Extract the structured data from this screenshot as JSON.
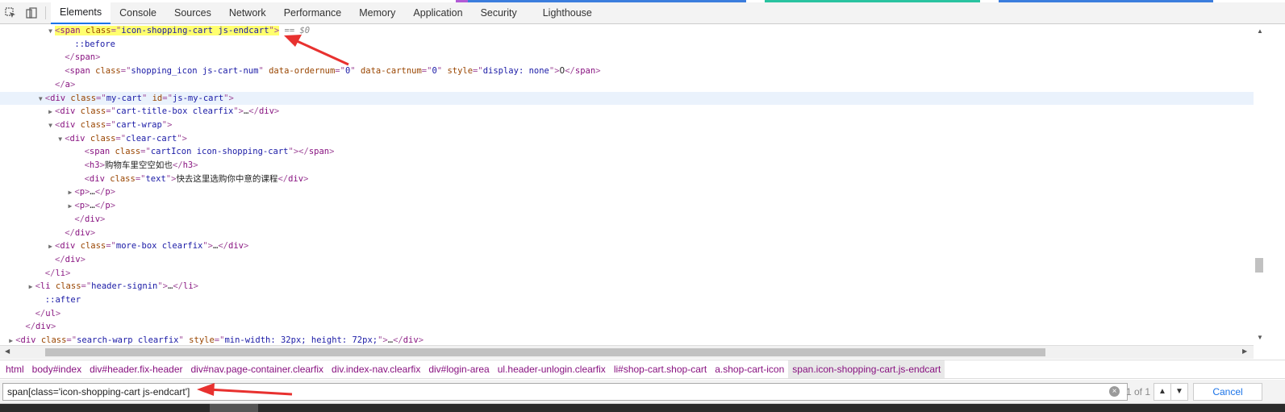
{
  "toolbar": {
    "tabs": [
      {
        "label": "Elements",
        "active": true
      },
      {
        "label": "Console"
      },
      {
        "label": "Sources"
      },
      {
        "label": "Network"
      },
      {
        "label": "Performance"
      },
      {
        "label": "Memory"
      },
      {
        "label": "Application"
      },
      {
        "label": "Security"
      },
      {
        "label": "Lighthouse"
      }
    ],
    "icons": [
      "inspect-icon",
      "device-toggle-icon"
    ]
  },
  "tree": {
    "lines": [
      {
        "indent": 5,
        "tri": "open",
        "selected_hl": true,
        "parts": [
          [
            "br",
            "<"
          ],
          [
            "tag",
            "span"
          ],
          [
            "sp",
            " "
          ],
          [
            "attr",
            "class"
          ],
          [
            "br",
            "=\""
          ],
          [
            "val",
            "icon-shopping-cart js-endcart"
          ],
          [
            "br",
            "\">"
          ]
        ],
        "suffix": " == $0"
      },
      {
        "indent": 7,
        "parts": [
          [
            "pseudo",
            "::before"
          ]
        ]
      },
      {
        "indent": 6,
        "parts": [
          [
            "br",
            "</"
          ],
          [
            "tag",
            "span"
          ],
          [
            "br",
            ">"
          ]
        ]
      },
      {
        "indent": 6,
        "parts": [
          [
            "br",
            "<"
          ],
          [
            "tag",
            "span"
          ],
          [
            "sp",
            " "
          ],
          [
            "attr",
            "class"
          ],
          [
            "br",
            "=\""
          ],
          [
            "val",
            "shopping_icon js-cart-num"
          ],
          [
            "br",
            "\""
          ],
          [
            "sp",
            " "
          ],
          [
            "attr",
            "data-ordernum"
          ],
          [
            "br",
            "=\""
          ],
          [
            "val",
            "0"
          ],
          [
            "br",
            "\""
          ],
          [
            "sp",
            " "
          ],
          [
            "attr",
            "data-cartnum"
          ],
          [
            "br",
            "=\""
          ],
          [
            "val",
            "0"
          ],
          [
            "br",
            "\""
          ],
          [
            "sp",
            " "
          ],
          [
            "attr",
            "style"
          ],
          [
            "br",
            "=\""
          ],
          [
            "val",
            "display: none"
          ],
          [
            "br",
            "\">"
          ],
          [
            "txt",
            "0"
          ],
          [
            "br",
            "</"
          ],
          [
            "tag",
            "span"
          ],
          [
            "br",
            ">"
          ]
        ]
      },
      {
        "indent": 5,
        "parts": [
          [
            "br",
            "</"
          ],
          [
            "tag",
            "a"
          ],
          [
            "br",
            ">"
          ]
        ]
      },
      {
        "indent": 4,
        "tri": "open",
        "selected": true,
        "parts": [
          [
            "br",
            "<"
          ],
          [
            "tag",
            "div"
          ],
          [
            "sp",
            " "
          ],
          [
            "attr",
            "class"
          ],
          [
            "br",
            "=\""
          ],
          [
            "val",
            "my-cart"
          ],
          [
            "br",
            "\""
          ],
          [
            "sp",
            " "
          ],
          [
            "attr",
            "id"
          ],
          [
            "br",
            "=\""
          ],
          [
            "val",
            "js-my-cart"
          ],
          [
            "br",
            "\">"
          ]
        ]
      },
      {
        "indent": 5,
        "tri": "closed",
        "parts": [
          [
            "br",
            "<"
          ],
          [
            "tag",
            "div"
          ],
          [
            "sp",
            " "
          ],
          [
            "attr",
            "class"
          ],
          [
            "br",
            "=\""
          ],
          [
            "val",
            "cart-title-box clearfix"
          ],
          [
            "br",
            "\">"
          ],
          [
            "ell",
            "…"
          ],
          [
            "br",
            "</"
          ],
          [
            "tag",
            "div"
          ],
          [
            "br",
            ">"
          ]
        ]
      },
      {
        "indent": 5,
        "tri": "open",
        "parts": [
          [
            "br",
            "<"
          ],
          [
            "tag",
            "div"
          ],
          [
            "sp",
            " "
          ],
          [
            "attr",
            "class"
          ],
          [
            "br",
            "=\""
          ],
          [
            "val",
            "cart-wrap"
          ],
          [
            "br",
            "\">"
          ]
        ]
      },
      {
        "indent": 6,
        "tri": "open",
        "parts": [
          [
            "br",
            "<"
          ],
          [
            "tag",
            "div"
          ],
          [
            "sp",
            " "
          ],
          [
            "attr",
            "class"
          ],
          [
            "br",
            "=\""
          ],
          [
            "val",
            "clear-cart"
          ],
          [
            "br",
            "\">"
          ]
        ]
      },
      {
        "indent": 8,
        "parts": [
          [
            "br",
            "<"
          ],
          [
            "tag",
            "span"
          ],
          [
            "sp",
            " "
          ],
          [
            "attr",
            "class"
          ],
          [
            "br",
            "=\""
          ],
          [
            "val",
            "cartIcon icon-shopping-cart"
          ],
          [
            "br",
            "\">"
          ],
          [
            "br",
            "</"
          ],
          [
            "tag",
            "span"
          ],
          [
            "br",
            ">"
          ]
        ]
      },
      {
        "indent": 8,
        "parts": [
          [
            "br",
            "<"
          ],
          [
            "tag",
            "h3"
          ],
          [
            "br",
            ">"
          ],
          [
            "txt",
            "购物车里空空如也"
          ],
          [
            "br",
            "</"
          ],
          [
            "tag",
            "h3"
          ],
          [
            "br",
            ">"
          ]
        ]
      },
      {
        "indent": 8,
        "parts": [
          [
            "br",
            "<"
          ],
          [
            "tag",
            "div"
          ],
          [
            "sp",
            " "
          ],
          [
            "attr",
            "class"
          ],
          [
            "br",
            "=\""
          ],
          [
            "val",
            "text"
          ],
          [
            "br",
            "\">"
          ],
          [
            "txt",
            "快去这里选购你中意的课程"
          ],
          [
            "br",
            "</"
          ],
          [
            "tag",
            "div"
          ],
          [
            "br",
            ">"
          ]
        ]
      },
      {
        "indent": 7,
        "tri": "closed",
        "parts": [
          [
            "br",
            "<"
          ],
          [
            "tag",
            "p"
          ],
          [
            "br",
            ">"
          ],
          [
            "ell",
            "…"
          ],
          [
            "br",
            "</"
          ],
          [
            "tag",
            "p"
          ],
          [
            "br",
            ">"
          ]
        ]
      },
      {
        "indent": 7,
        "tri": "closed",
        "parts": [
          [
            "br",
            "<"
          ],
          [
            "tag",
            "p"
          ],
          [
            "br",
            ">"
          ],
          [
            "ell",
            "…"
          ],
          [
            "br",
            "</"
          ],
          [
            "tag",
            "p"
          ],
          [
            "br",
            ">"
          ]
        ]
      },
      {
        "indent": 7,
        "parts": [
          [
            "br",
            "</"
          ],
          [
            "tag",
            "div"
          ],
          [
            "br",
            ">"
          ]
        ]
      },
      {
        "indent": 6,
        "parts": [
          [
            "br",
            "</"
          ],
          [
            "tag",
            "div"
          ],
          [
            "br",
            ">"
          ]
        ]
      },
      {
        "indent": 5,
        "tri": "closed",
        "parts": [
          [
            "br",
            "<"
          ],
          [
            "tag",
            "div"
          ],
          [
            "sp",
            " "
          ],
          [
            "attr",
            "class"
          ],
          [
            "br",
            "=\""
          ],
          [
            "val",
            "more-box clearfix"
          ],
          [
            "br",
            "\">"
          ],
          [
            "ell",
            "…"
          ],
          [
            "br",
            "</"
          ],
          [
            "tag",
            "div"
          ],
          [
            "br",
            ">"
          ]
        ]
      },
      {
        "indent": 5,
        "parts": [
          [
            "br",
            "</"
          ],
          [
            "tag",
            "div"
          ],
          [
            "br",
            ">"
          ]
        ]
      },
      {
        "indent": 4,
        "parts": [
          [
            "br",
            "</"
          ],
          [
            "tag",
            "li"
          ],
          [
            "br",
            ">"
          ]
        ]
      },
      {
        "indent": 3,
        "tri": "closed",
        "parts": [
          [
            "br",
            "<"
          ],
          [
            "tag",
            "li"
          ],
          [
            "sp",
            " "
          ],
          [
            "attr",
            "class"
          ],
          [
            "br",
            "=\""
          ],
          [
            "val",
            "header-signin"
          ],
          [
            "br",
            "\">"
          ],
          [
            "ell",
            "…"
          ],
          [
            "br",
            "</"
          ],
          [
            "tag",
            "li"
          ],
          [
            "br",
            ">"
          ]
        ]
      },
      {
        "indent": 4,
        "parts": [
          [
            "pseudo",
            "::after"
          ]
        ]
      },
      {
        "indent": 3,
        "parts": [
          [
            "br",
            "</"
          ],
          [
            "tag",
            "ul"
          ],
          [
            "br",
            ">"
          ]
        ]
      },
      {
        "indent": 2,
        "parts": [
          [
            "br",
            "</"
          ],
          [
            "tag",
            "div"
          ],
          [
            "br",
            ">"
          ]
        ]
      },
      {
        "indent": 1,
        "tri": "closed",
        "parts": [
          [
            "br",
            "<"
          ],
          [
            "tag",
            "div"
          ],
          [
            "sp",
            " "
          ],
          [
            "attr",
            "class"
          ],
          [
            "br",
            "=\""
          ],
          [
            "val",
            "search-warp clearfix"
          ],
          [
            "br",
            "\""
          ],
          [
            "sp",
            " "
          ],
          [
            "attr",
            "style"
          ],
          [
            "br",
            "=\""
          ],
          [
            "val",
            "min-width: 32px; height: 72px;"
          ],
          [
            "br",
            "\">"
          ],
          [
            "ell",
            "…"
          ],
          [
            "br",
            "</"
          ],
          [
            "tag",
            "div"
          ],
          [
            "br",
            ">"
          ]
        ]
      }
    ]
  },
  "breadcrumbs": [
    {
      "tag": "html",
      "cls": ""
    },
    {
      "tag": "body",
      "cls": "#index"
    },
    {
      "tag": "div",
      "cls": "#header.fix-header"
    },
    {
      "tag": "div",
      "cls": "#nav.page-container.clearfix"
    },
    {
      "tag": "div",
      "cls": ".index-nav.clearfix"
    },
    {
      "tag": "div",
      "cls": "#login-area"
    },
    {
      "tag": "ul",
      "cls": ".header-unlogin.clearfix"
    },
    {
      "tag": "li",
      "cls": "#shop-cart.shop-cart"
    },
    {
      "tag": "a",
      "cls": ".shop-cart-icon"
    },
    {
      "tag": "span",
      "cls": ".icon-shopping-cart.js-endcart",
      "active": true
    }
  ],
  "search": {
    "value": "span[class='icon-shopping-cart js-endcart']",
    "match_count": "1 of 1",
    "cancel_label": "Cancel",
    "clear_icon": "clear-icon",
    "prev_icon": "chevron-up-icon",
    "next_icon": "chevron-down-icon"
  },
  "colors": {
    "highlight": "#ffff6e",
    "selected_row": "#eaf2fc",
    "annotation_arrow": "#e8312f",
    "active_tab_underline": "#1a73e8"
  }
}
